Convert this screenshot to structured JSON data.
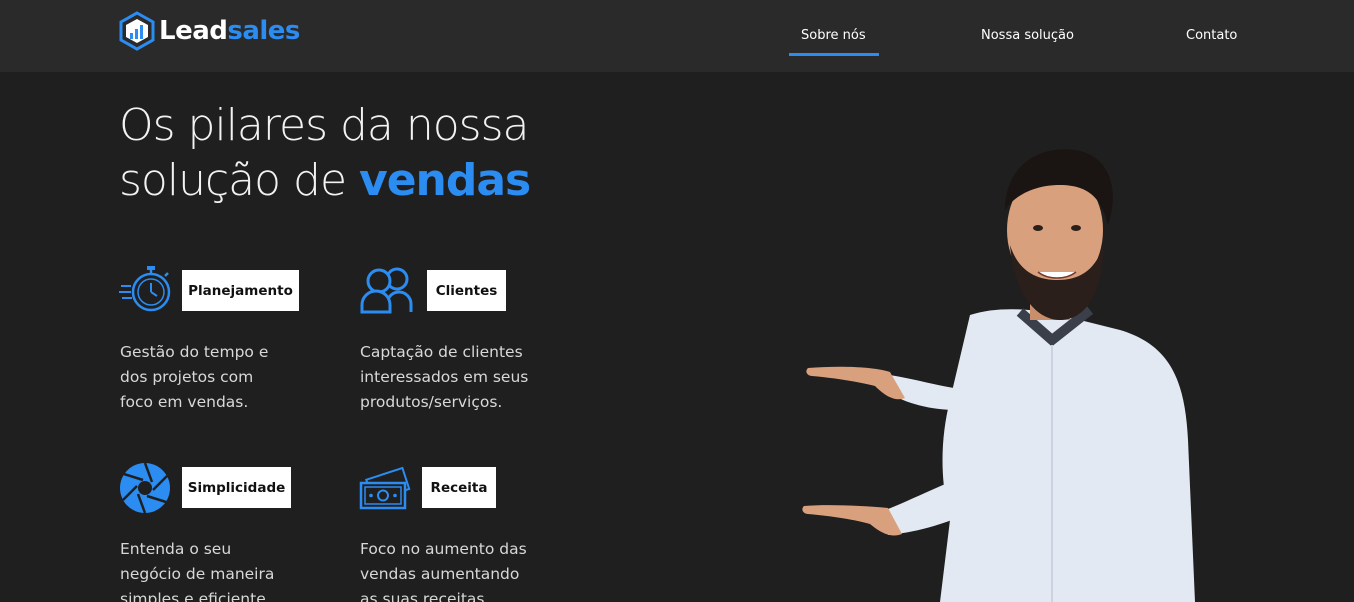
{
  "brand": {
    "name_part1": "Lead",
    "name_part2": "sales",
    "accent_color": "#2b8cf2"
  },
  "nav": {
    "items": [
      {
        "label": "Sobre nós",
        "active": true
      },
      {
        "label": "Nossa solução",
        "active": false
      },
      {
        "label": "Contato",
        "active": false
      }
    ]
  },
  "hero": {
    "title_line1": "Os pilares da nossa",
    "title_line2_prefix": "solução de ",
    "title_line2_accent": "vendas"
  },
  "features": [
    {
      "label": "Planejamento",
      "icon": "stopwatch-icon",
      "description": "Gestão do tempo e dos projetos com foco em vendas."
    },
    {
      "label": "Clientes",
      "icon": "users-icon",
      "description": "Captação de clientes interessados em seus produtos/serviços."
    },
    {
      "label": "Simplicidade",
      "icon": "aperture-icon",
      "description": "Entenda o seu negócio de maneira simples e eficiente."
    },
    {
      "label": "Receita",
      "icon": "money-icon",
      "description": "Foco no aumento das vendas aumentando as suas receitas."
    }
  ]
}
